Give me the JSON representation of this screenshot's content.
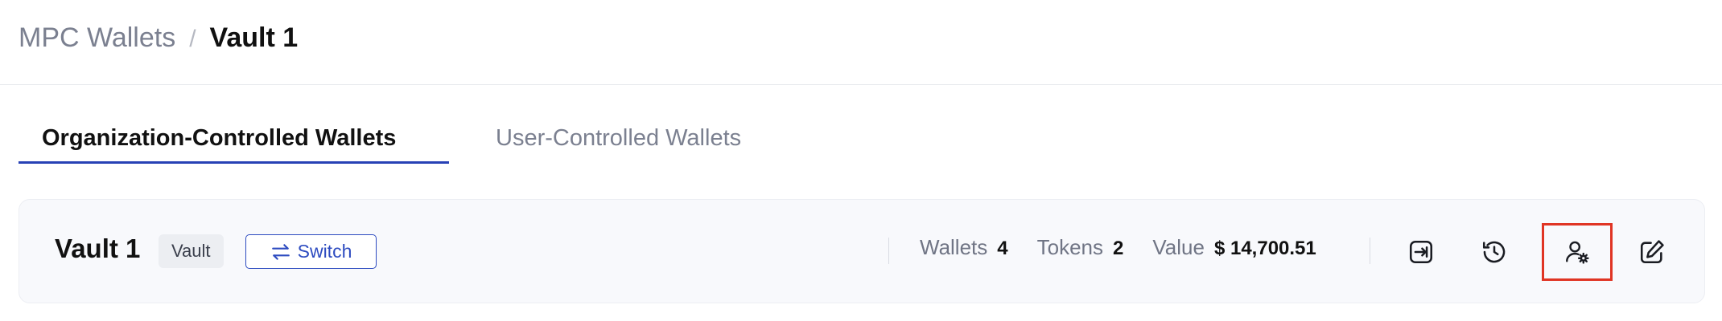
{
  "breadcrumb": {
    "root": "MPC Wallets",
    "separator": "/",
    "current": "Vault 1"
  },
  "tabs": [
    {
      "label": "Organization-Controlled Wallets",
      "active": true
    },
    {
      "label": "User-Controlled Wallets",
      "active": false
    }
  ],
  "vault": {
    "name": "Vault 1",
    "badge": "Vault",
    "switch_label": "Switch",
    "stats": [
      {
        "label": "Wallets",
        "value": "4"
      },
      {
        "label": "Tokens",
        "value": "2"
      },
      {
        "label": "Value",
        "value": "$ 14,700.51"
      }
    ],
    "actions": [
      {
        "icon": "transfer-in-icon"
      },
      {
        "icon": "history-icon"
      },
      {
        "icon": "user-settings-icon",
        "highlighted": true
      },
      {
        "icon": "edit-icon"
      }
    ]
  },
  "colors": {
    "accent": "#2741b5",
    "highlight": "#e03524",
    "muted_text": "#7b8090",
    "card_bg": "#f8f9fc"
  }
}
